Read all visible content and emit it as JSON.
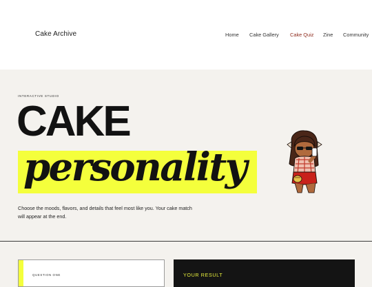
{
  "header": {
    "brand": "Cake Archive",
    "nav": [
      {
        "label": "Home",
        "active": false
      },
      {
        "label": "Cake Gallery",
        "active": false
      },
      {
        "label": "Cake Quiz",
        "active": true
      },
      {
        "label": "Zine",
        "active": false
      },
      {
        "label": "Community",
        "active": false
      }
    ]
  },
  "hero": {
    "eyebrow": "INTERACTIVE STUDIO",
    "title_line1": "CAKE",
    "title_line2": "personality",
    "intro": "Choose the moods, flavors, and details that feel most like you. Your cake match will appear at the end."
  },
  "quiz": {
    "question_label": "QUESTION ONE"
  },
  "result": {
    "label": "YOUR RESULT"
  },
  "colors": {
    "highlight": "#f4ff3c",
    "active_nav": "#8f2d1f",
    "background": "#f4f2ee"
  },
  "icons": {
    "mascot": "girl-eating-cake-illustration"
  }
}
